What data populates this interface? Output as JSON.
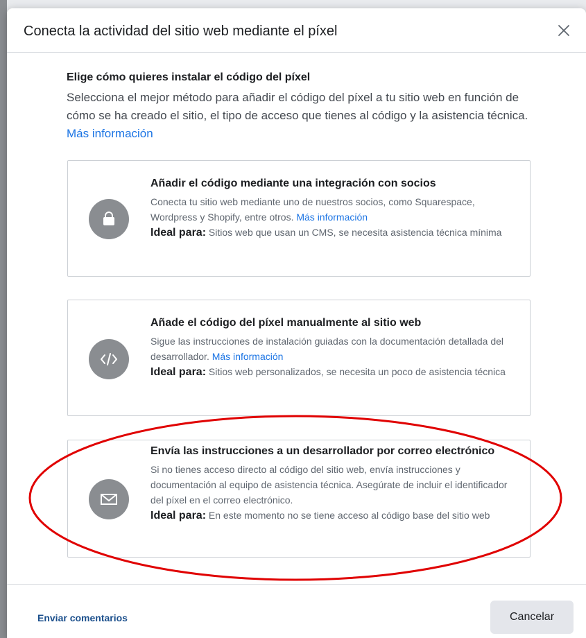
{
  "dialog": {
    "title": "Conecta la actividad del sitio web mediante el píxel",
    "close_icon": "close-icon"
  },
  "intro": {
    "heading": "Elige cómo quieres instalar el código del píxel",
    "body": "Selecciona el mejor método para añadir el código del píxel a tu sitio web en función de cómo se ha creado el sitio, el tipo de acceso que tienes al código y la asistencia técnica.",
    "link": "Más información"
  },
  "options": [
    {
      "icon": "shopping-bag-icon",
      "title": "Añadir el código mediante una integración con socios",
      "body": "Conecta tu sitio web mediante uno de nuestros socios, como Squarespace, Wordpress y Shopify, entre otros.",
      "link": "Más información",
      "ideal_label": "Ideal para:",
      "ideal_text": "Sitios web que usan un CMS, se necesita asistencia técnica mínima"
    },
    {
      "icon": "code-icon",
      "title": "Añade el código del píxel manualmente al sitio web",
      "body": "Sigue las instrucciones de instalación guiadas con la documentación detallada del desarrollador.",
      "link": "Más información",
      "ideal_label": "Ideal para:",
      "ideal_text": "Sitios web personalizados, se necesita un poco de asistencia técnica"
    },
    {
      "icon": "envelope-icon",
      "title": "Envía las instrucciones a un desarrollador por correo electrónico",
      "body": "Si no tienes acceso directo al código del sitio web, envía instrucciones y documentación al equipo de asistencia técnica. Asegúrate de incluir el identificador del píxel en el correo electrónico.",
      "ideal_label": "Ideal para:",
      "ideal_text": "En este momento no se tiene acceso al código base del sitio web"
    }
  ],
  "footer": {
    "feedback_label": "Enviar comentarios",
    "cancel_label": "Cancelar"
  },
  "colors": {
    "link": "#1b74e4",
    "icon_bg": "#8a8d91",
    "highlight": "#e00000"
  }
}
